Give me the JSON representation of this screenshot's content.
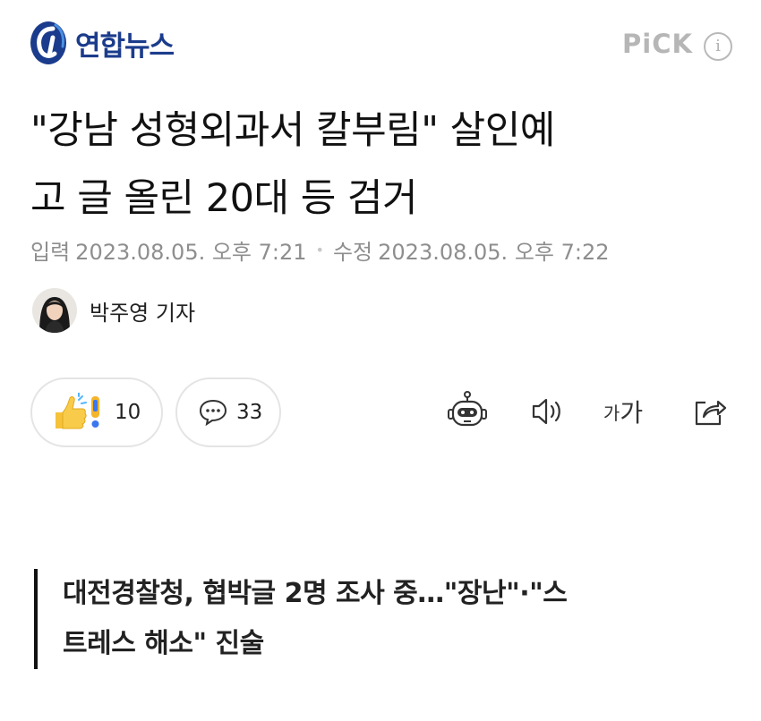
{
  "header": {
    "brand_name": "연합뉴스",
    "pick_label": "PiCK",
    "info_icon": "info-icon",
    "brand_color": "#1b3c8c"
  },
  "article": {
    "headline_line1": "\"강남 성형외과서 칼부림\" 살인예",
    "headline_line2": "고 글 올린 20대 등 검거",
    "input_label": "입력",
    "input_datetime": "2023.08.05. 오후 7:21",
    "modified_label": "수정",
    "modified_datetime": "2023.08.05. 오후 7:22",
    "reporter": "박주영 기자",
    "subheadline_line1": "대전경찰청, 협박글 2명 조사 중…\"장난\"·\"스",
    "subheadline_line2": "트레스 해소\" 진술"
  },
  "actions": {
    "reaction_count": "10",
    "comment_count": "33",
    "font_size_small": "가",
    "font_size_large": "가",
    "icons": [
      "reaction-icon",
      "comment-icon",
      "robot-summary-icon",
      "speaker-icon",
      "font-size-icon",
      "share-icon"
    ]
  }
}
